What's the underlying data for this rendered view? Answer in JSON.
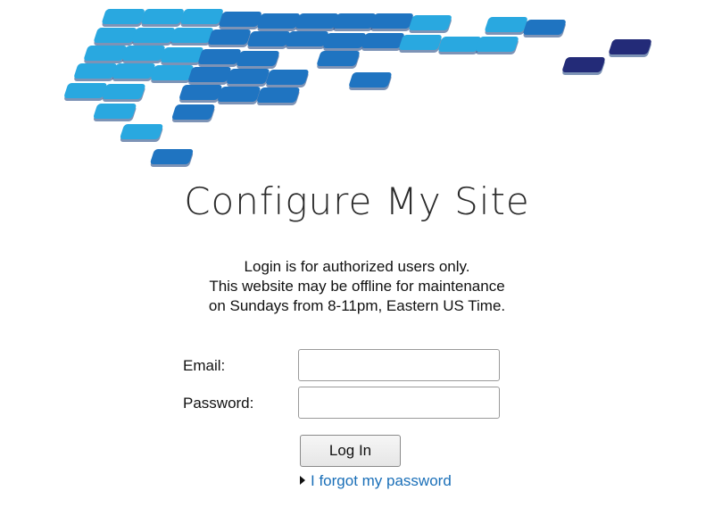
{
  "logo": {
    "icon": "pixel-mosaic-logo",
    "colors": {
      "light": "#29a8e0",
      "mid": "#1f74c1",
      "dark": "#1a3a8f",
      "navy": "#232b78"
    }
  },
  "page": {
    "title": "Configure My Site",
    "notice_lines": [
      "Login is for authorized users only.",
      "This website may be offline for maintenance",
      "on Sundays from 8-11pm, Eastern US Time."
    ]
  },
  "form": {
    "email_label": "Email:",
    "email_value": "",
    "password_label": "Password:",
    "password_value": "",
    "login_button_label": "Log In",
    "forgot_password_label": "I forgot my password",
    "link_color": "#1a6fb8"
  }
}
